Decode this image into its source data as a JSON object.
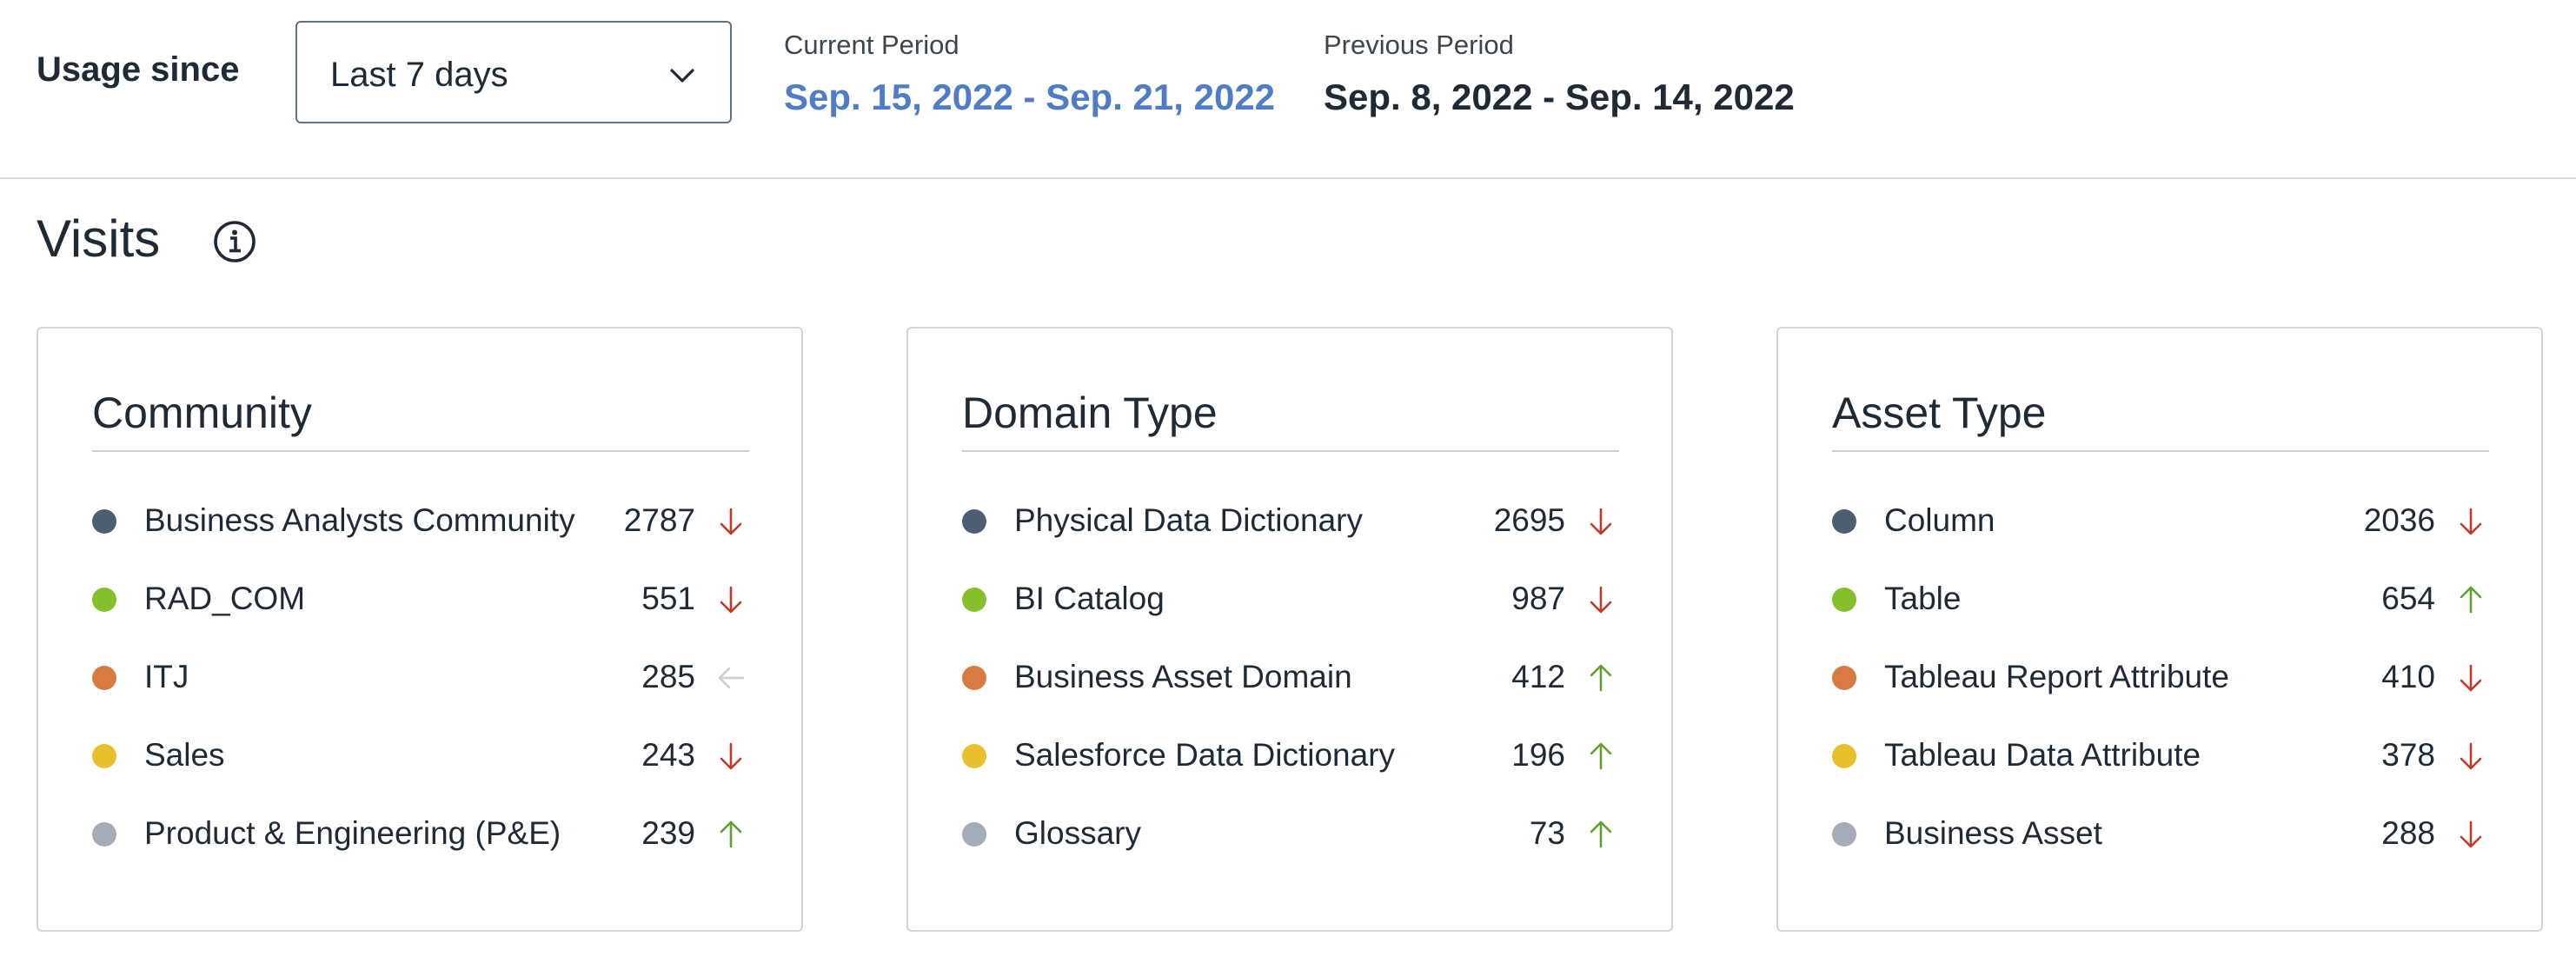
{
  "usage_label": "Usage since",
  "period_select": {
    "value": "Last 7 days"
  },
  "current_period": {
    "label": "Current Period",
    "value": "Sep. 15, 2022 - Sep. 21, 2022"
  },
  "previous_period": {
    "label": "Previous Period",
    "value": "Sep. 8, 2022 - Sep. 14, 2022"
  },
  "section": {
    "title": "Visits"
  },
  "colors": {
    "current_period": "#4f7cc6",
    "trend_down": "#c0392b",
    "trend_up": "#5fa12e",
    "trend_neutral": "#c9ced4",
    "series": [
      "#4d5e70",
      "#85bf2b",
      "#d77b42",
      "#e8c02e",
      "#a3adb7"
    ]
  },
  "cards": [
    {
      "title": "Community",
      "rows": [
        {
          "label": "Business Analysts Community",
          "value": "2787",
          "trend": "down"
        },
        {
          "label": "RAD_COM",
          "value": "551",
          "trend": "down"
        },
        {
          "label": "ITJ",
          "value": "285",
          "trend": "neutral"
        },
        {
          "label": "Sales",
          "value": "243",
          "trend": "down"
        },
        {
          "label": "Product & Engineering (P&E)",
          "value": "239",
          "trend": "up"
        }
      ]
    },
    {
      "title": "Domain Type",
      "rows": [
        {
          "label": "Physical Data Dictionary",
          "value": "2695",
          "trend": "down"
        },
        {
          "label": "BI Catalog",
          "value": "987",
          "trend": "down"
        },
        {
          "label": "Business Asset Domain",
          "value": "412",
          "trend": "up"
        },
        {
          "label": "Salesforce Data Dictionary",
          "value": "196",
          "trend": "up"
        },
        {
          "label": "Glossary",
          "value": "73",
          "trend": "up"
        }
      ]
    },
    {
      "title": "Asset Type",
      "rows": [
        {
          "label": "Column",
          "value": "2036",
          "trend": "down"
        },
        {
          "label": "Table",
          "value": "654",
          "trend": "up"
        },
        {
          "label": "Tableau Report Attribute",
          "value": "410",
          "trend": "down"
        },
        {
          "label": "Tableau Data Attribute",
          "value": "378",
          "trend": "down"
        },
        {
          "label": "Business Asset",
          "value": "288",
          "trend": "down"
        }
      ]
    }
  ]
}
